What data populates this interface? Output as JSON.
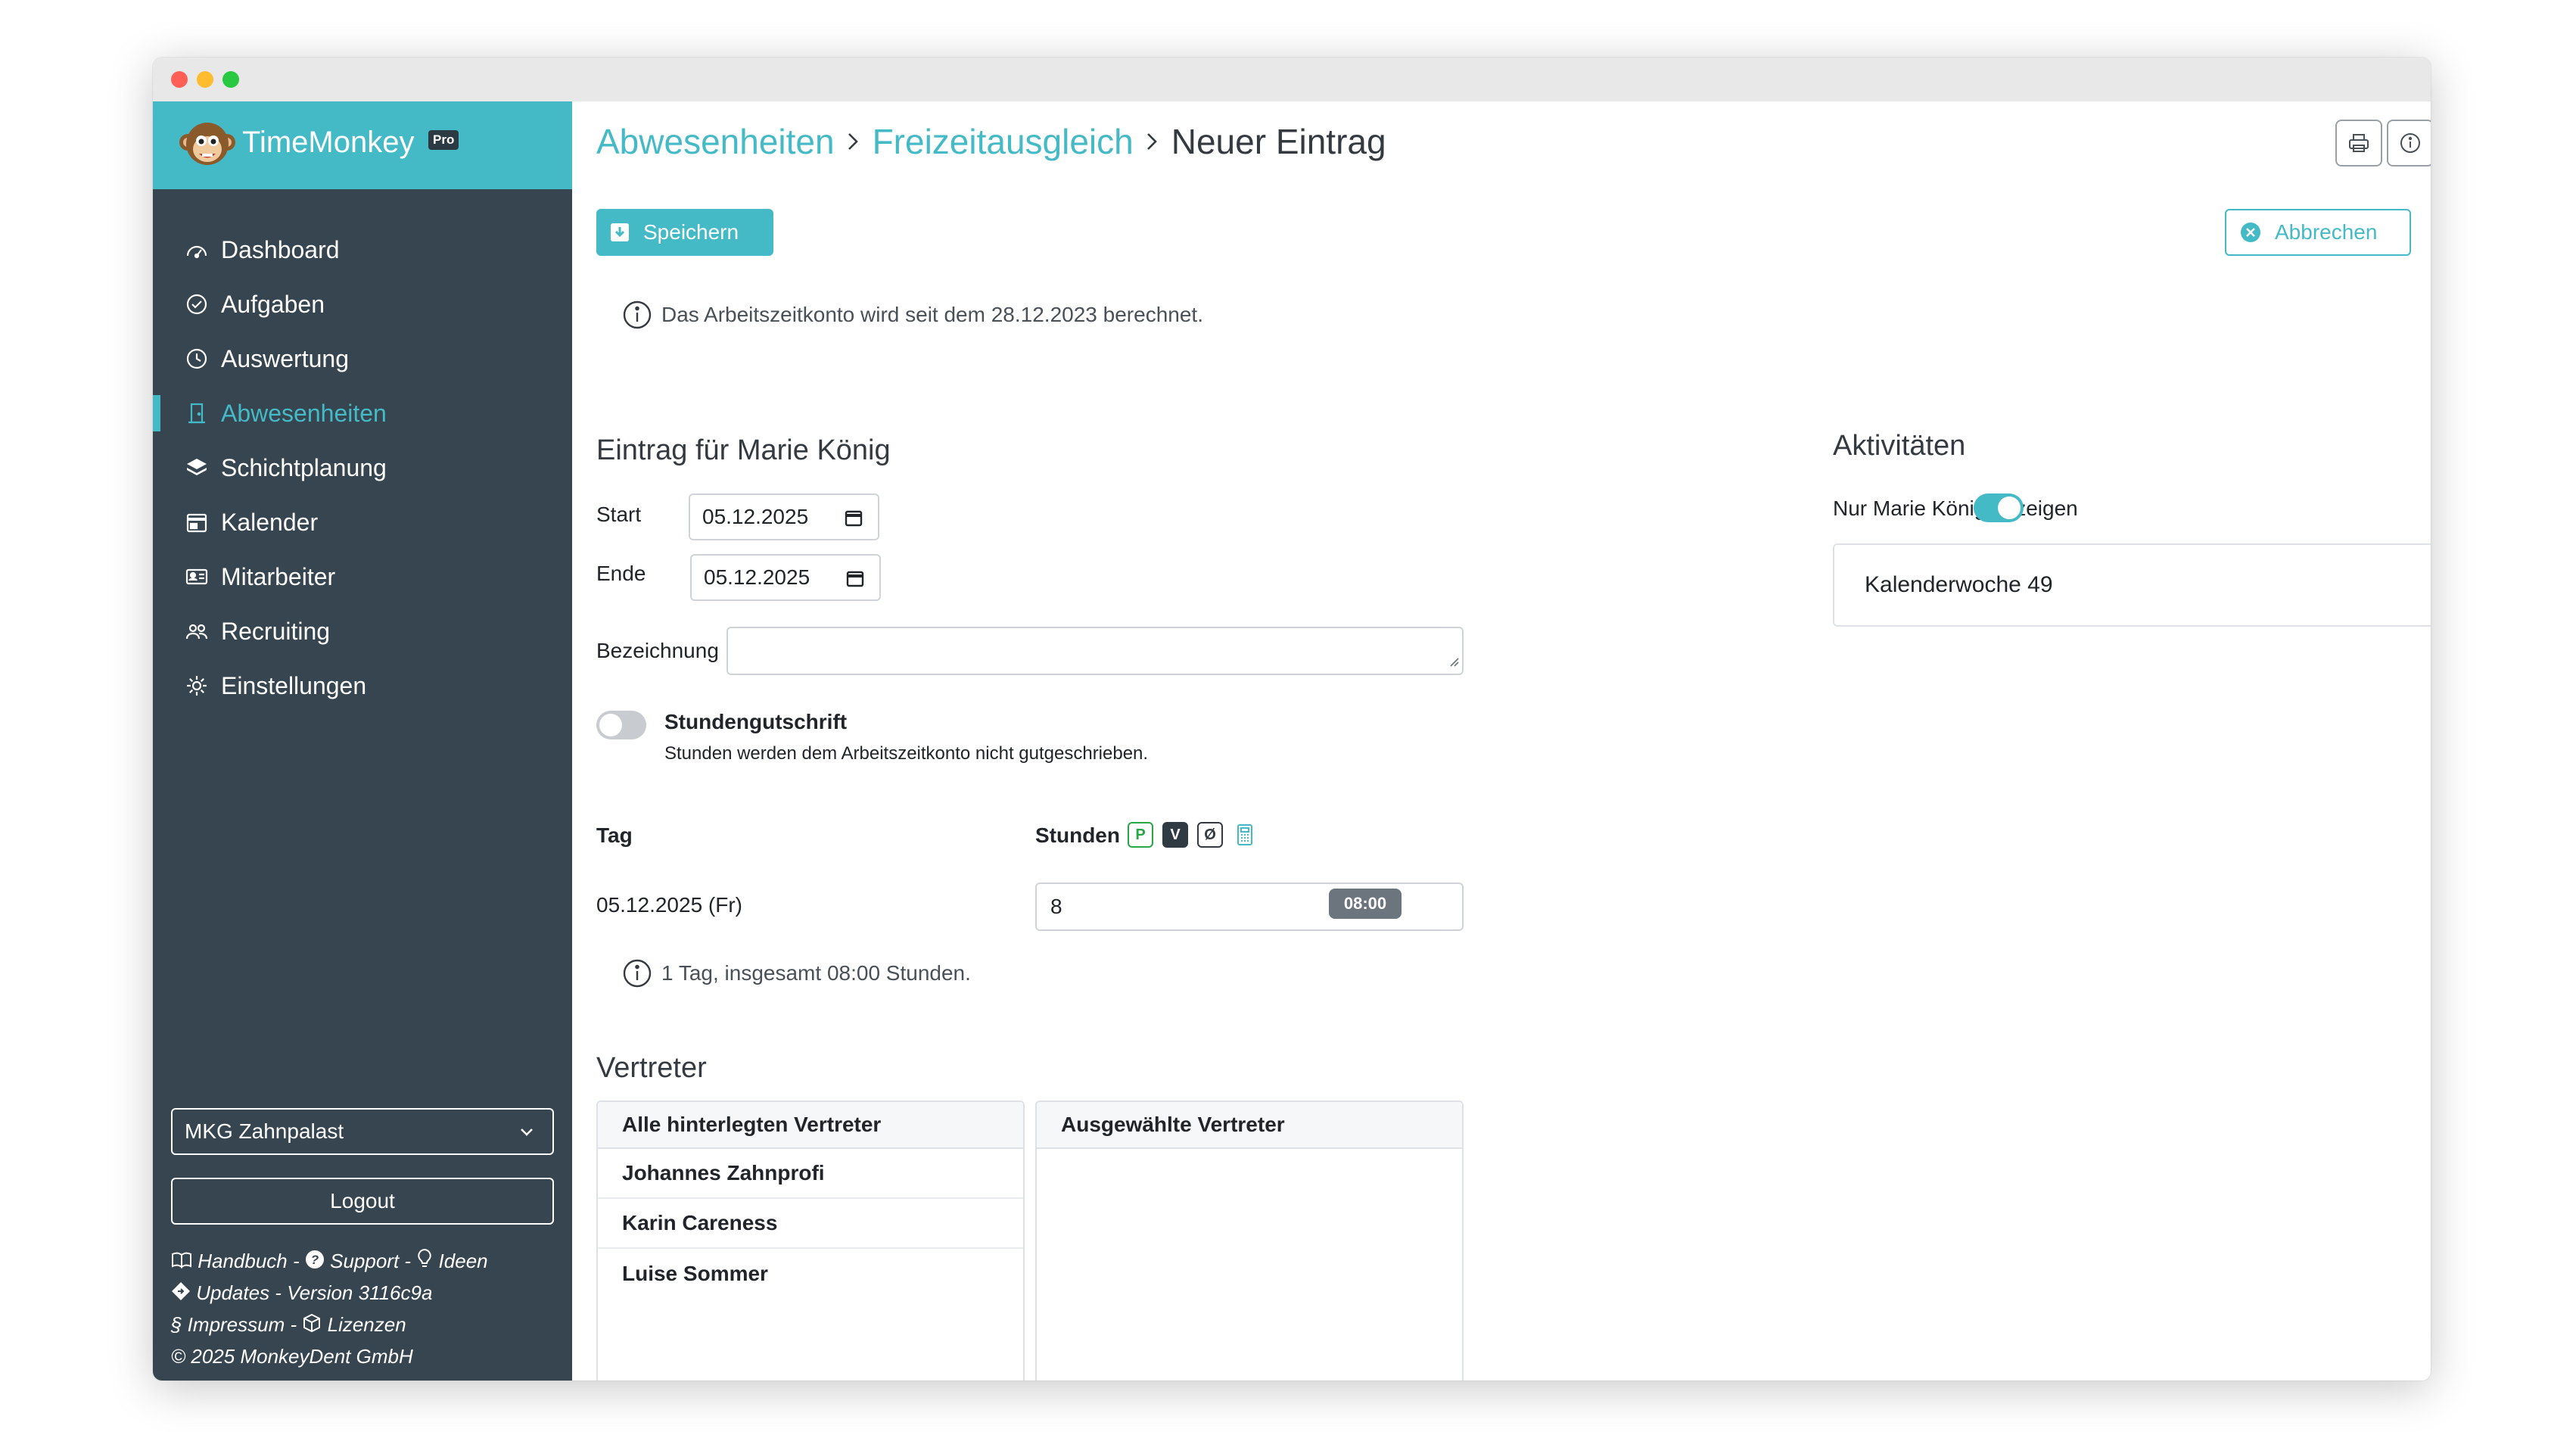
{
  "app": {
    "name": "TimeMonkey",
    "plan_badge": "Pro",
    "accent_color": "#45bac7",
    "sidebar_color": "#36454f"
  },
  "sidebar": {
    "items": [
      {
        "label": "Dashboard",
        "icon": "gauge-icon",
        "active": false
      },
      {
        "label": "Aufgaben",
        "icon": "check-circle-icon",
        "active": false
      },
      {
        "label": "Auswertung",
        "icon": "clock-icon",
        "active": false
      },
      {
        "label": "Abwesenheiten",
        "icon": "door-icon",
        "active": true
      },
      {
        "label": "Schichtplanung",
        "icon": "layers-icon",
        "active": false
      },
      {
        "label": "Kalender",
        "icon": "calendar-icon",
        "active": false
      },
      {
        "label": "Mitarbeiter",
        "icon": "id-card-icon",
        "active": false
      },
      {
        "label": "Recruiting",
        "icon": "people-icon",
        "active": false
      },
      {
        "label": "Einstellungen",
        "icon": "gear-icon",
        "active": false
      }
    ],
    "company_select": "MKG Zahnpalast",
    "logout_label": "Logout",
    "footer": {
      "handbook": "Handbuch",
      "sep": " - ",
      "support": "Support",
      "ideas": "Ideen",
      "updates": "Updates",
      "version": "Version 3116c9a",
      "imprint": "§ Impressum",
      "licenses": "Lizenzen",
      "copyright": "© 2025 MonkeyDent GmbH"
    }
  },
  "header": {
    "crumb1": "Abwesenheiten",
    "crumb2": "Freizeitausgleich",
    "current": "Neuer Eintrag"
  },
  "toolbar": {
    "save_label": "Speichern",
    "cancel_label": "Abbrechen"
  },
  "account_info": "Das Arbeitszeitkonto wird seit dem 28.12.2023 berechnet.",
  "entry": {
    "title": "Eintrag für Marie König",
    "start_label": "Start",
    "start_value": "05.12.2025",
    "end_label": "Ende",
    "end_value": "05.12.2025",
    "name_label": "Bezeichnung",
    "name_value": "",
    "credit_toggle_label": "Stundengutschrift",
    "credit_toggle_help": "Stunden werden dem Arbeitszeitkonto nicht gutgeschrieben.",
    "credit_enabled": false
  },
  "days_table": {
    "col_day": "Tag",
    "col_hours": "Stunden",
    "modes": [
      "P",
      "V",
      "Ø"
    ],
    "rows": [
      {
        "day": "05.12.2025 (Fr)",
        "planned": "08:00",
        "hours": "8"
      }
    ],
    "summary": "1 Tag, insgesamt 08:00 Stunden."
  },
  "substitutes": {
    "title": "Vertreter",
    "all_header": "Alle hinterlegten Vertreter",
    "all": [
      "Johannes Zahnprofi",
      "Karin Careness",
      "Luise Sommer"
    ],
    "selected_header": "Ausgewählte Vertreter",
    "selected": []
  },
  "activities": {
    "title": "Aktivitäten",
    "filter_label": "Nur Marie König anzeigen",
    "filter_enabled": true,
    "week_label": "Kalenderwoche 49"
  }
}
